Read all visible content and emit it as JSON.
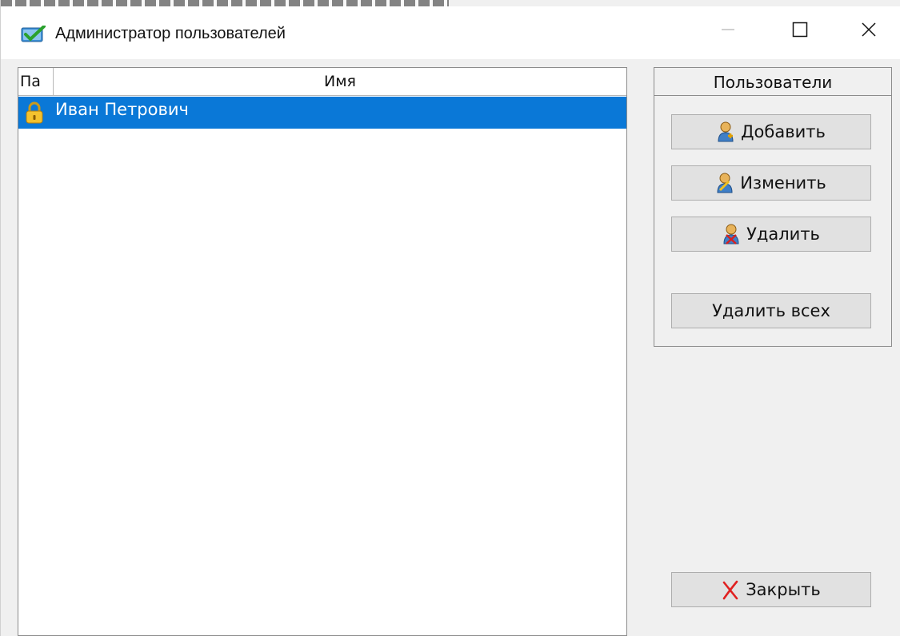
{
  "window": {
    "title": "Администратор пользователей",
    "icon": "checkmark-app-icon"
  },
  "title_buttons": {
    "minimize": "minimize-icon",
    "maximize": "maximize-icon",
    "close": "close-icon"
  },
  "list": {
    "columns": [
      "Па",
      "Имя"
    ],
    "rows": [
      {
        "icon": "lock-icon",
        "name": "Иван Петрович",
        "selected": true
      }
    ],
    "selection_color": "#0a78d7"
  },
  "users_group": {
    "title": "Пользователи",
    "buttons": {
      "add": "Добавить",
      "edit": "Изменить",
      "delete": "Удалить",
      "delete_all": "Удалить всех"
    }
  },
  "close_button": {
    "label": "Закрыть",
    "icon": "red-x-icon"
  }
}
